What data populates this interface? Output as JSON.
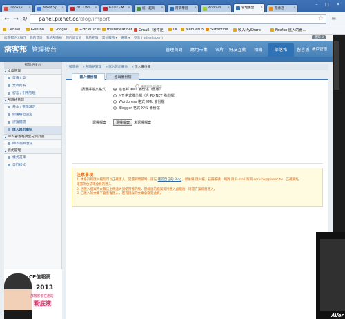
{
  "browser": {
    "tabs": [
      {
        "title": "Inbox (2",
        "favicon": "#d44b3b"
      },
      {
        "title": "Alfred Sp",
        "favicon": "#3a7bd5"
      },
      {
        "title": "2013 Wo",
        "favicon": "#c0282d"
      },
      {
        "title": "Finals - M",
        "favicon": "#c0282d"
      },
      {
        "title": "統一超商",
        "favicon": "#4c8f3a"
      },
      {
        "title": "阿華學習",
        "favicon": "#2a6fb1"
      },
      {
        "title": "Android",
        "favicon": "#9acd32"
      },
      {
        "title": "管理後台",
        "favicon": "#2f72b5"
      },
      {
        "title": "隨意窩",
        "favicon": "#e48a1c"
      }
    ],
    "url_host": "panel.pixnet.cc",
    "url_path": "/blog/import",
    "bookmarks": [
      "Debian",
      "Gentoo",
      "Google",
      "+HEMiDEMi",
      "freshmeat.net",
      "Gmail - 收件匣",
      "DL",
      "MenuetOS",
      "Subscribe...",
      "收入MyShare",
      "Firefox 匯入的書..."
    ]
  },
  "util": {
    "links": [
      "痞客邦 PIXNET",
      "我的首頁",
      "我的部落格",
      "我的留言板",
      "我的相簿",
      "其他服務 ▾",
      "選單 ▾",
      "登出 ( alfredlager )"
    ],
    "highlight": "通知 0"
  },
  "header": {
    "logo": "痞客邦",
    "logo_sub": "管理後台",
    "nav": [
      "管理首頁",
      "應用市集",
      "名片",
      "好友互動",
      "相簿",
      "部落格",
      "留言板",
      "帳戶管理"
    ],
    "active": "部落格"
  },
  "sidebar": {
    "top": "部落格後台",
    "sections": [
      {
        "title": "文章管理",
        "items": [
          "發表文章",
          "文章列表",
          "留言 / 引用管理"
        ]
      },
      {
        "title": "部落格管理",
        "items": [
          "基本 / 進階設定",
          "側邊欄位設定",
          "評論關閉",
          "匯入匯出備份"
        ]
      },
      {
        "title": "MIB 部落格廣告分潤計畫",
        "items": [
          "MIB 帳戶資訊"
        ]
      },
      {
        "title": "樣式管理",
        "items": [
          "樣式選擇",
          "自訂樣式"
        ]
      }
    ],
    "active_item": "匯入匯出備份",
    "ad": {
      "line1": "CP值超高",
      "line2": "2013",
      "line3": "部落客都在用的",
      "line4": "粉底液"
    }
  },
  "breadcrumb": [
    "部落格",
    "部落格管理",
    "匯入匯出備份",
    "匯入備份檔"
  ],
  "page_tabs": [
    "匯入備份檔",
    "匯出備份檔"
  ],
  "form": {
    "format_label": "請選擇檔案格式",
    "formats": [
      "痞客邦 XML 備份檔（舊版）",
      "MT 格式備份檔（含 PIXNET 備份檔）",
      "Wordpress 格式 XML 備份檔",
      "Blogger 格式 XML 備份檔"
    ],
    "selected_format": 0,
    "hint": "未選取任何檔案",
    "file_label": "選擇檔案",
    "file_button": "選擇檔案",
    "file_status": "未選擇檔案"
  },
  "notice": {
    "title": "注意事項",
    "items": [
      {
        "pre": "1. 本系列所匯入檔案可以正確匯入，當遇到問題時，請先 ",
        "link": "確認自己的 Blog",
        "post": "，然後將 匯入檔、註冊帳號、網頁 與 E-mail 寄到 service@pixnet.tw，正確網址"
      },
      {
        "pre": "    確認為合法或會員的匯入",
        "link": "",
        "post": ""
      },
      {
        "pre": "2. 因匯入檔案不大無法上傳過大請使用舊的版，壓縮過的檔案等待匯入處理後，確認方案即將匯入。",
        "link": "",
        "post": ""
      },
      {
        "pre": "3. 已匯入的文章不會重複匯入，若有錯誤的文章會寫到此頁。",
        "link": "",
        "post": ""
      }
    ]
  },
  "overlay": {
    "brand": "AVer"
  }
}
